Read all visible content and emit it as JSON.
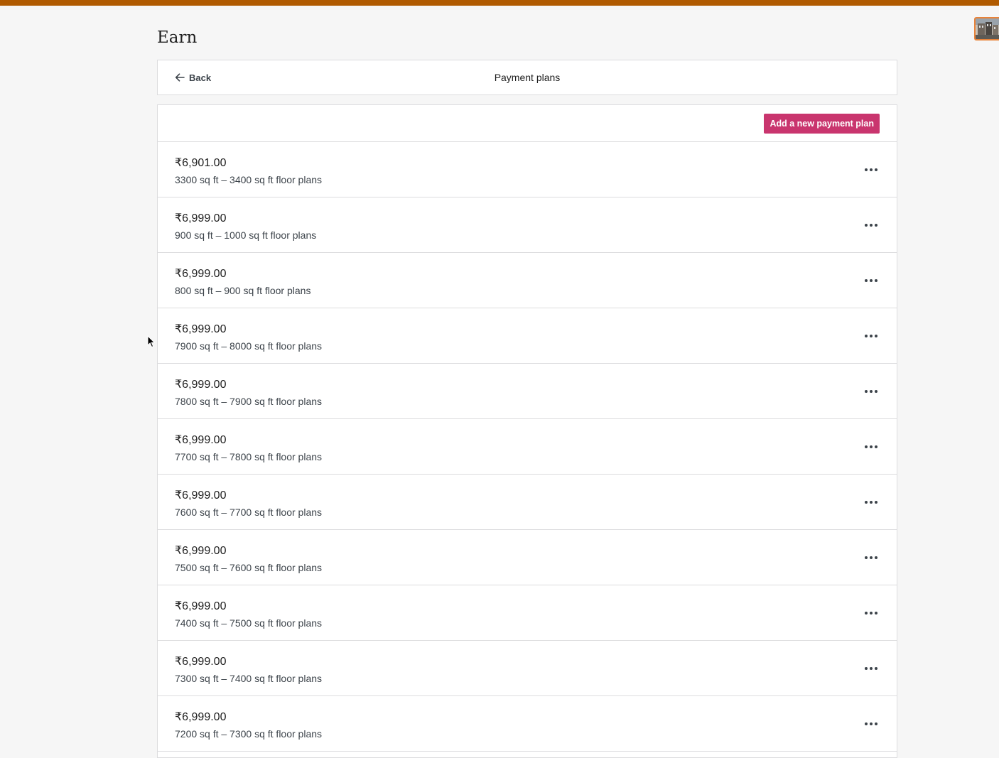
{
  "page": {
    "title": "Earn"
  },
  "header": {
    "back_label": "Back",
    "title": "Payment plans"
  },
  "toolbar": {
    "add_label": "Add a new payment plan"
  },
  "colors": {
    "accent": "#c9356e",
    "top_bar": "#b05a00"
  },
  "plans": [
    {
      "price": "₹6,901.00",
      "description": "3300 sq ft – 3400 sq ft floor plans"
    },
    {
      "price": "₹6,999.00",
      "description": "900 sq ft – 1000 sq ft floor plans"
    },
    {
      "price": "₹6,999.00",
      "description": "800 sq ft – 900 sq ft floor plans"
    },
    {
      "price": "₹6,999.00",
      "description": "7900 sq ft – 8000 sq ft floor plans"
    },
    {
      "price": "₹6,999.00",
      "description": "7800 sq ft – 7900 sq ft floor plans"
    },
    {
      "price": "₹6,999.00",
      "description": "7700 sq ft – 7800 sq ft floor plans"
    },
    {
      "price": "₹6,999.00",
      "description": "7600 sq ft – 7700 sq ft floor plans"
    },
    {
      "price": "₹6,999.00",
      "description": "7500 sq ft – 7600 sq ft floor plans"
    },
    {
      "price": "₹6,999.00",
      "description": "7400 sq ft – 7500 sq ft floor plans"
    },
    {
      "price": "₹6,999.00",
      "description": "7300 sq ft – 7400 sq ft floor plans"
    },
    {
      "price": "₹6,999.00",
      "description": "7200 sq ft – 7300 sq ft floor plans"
    }
  ]
}
